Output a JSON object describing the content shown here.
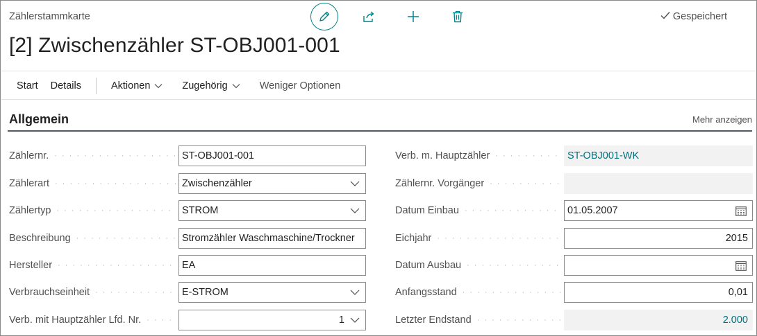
{
  "header": {
    "caption": "Zählerstammkarte",
    "title": "[2] Zwischenzähler ST-OBJ001-001",
    "status": "Gespeichert",
    "icons": [
      "edit-pencil-icon",
      "share-icon",
      "add-icon",
      "delete-icon",
      "checkmark-icon"
    ]
  },
  "actionbar": {
    "start": "Start",
    "details": "Details",
    "aktionen": "Aktionen",
    "zugehoerig": "Zugehörig",
    "weniger": "Weniger Optionen"
  },
  "section": {
    "title": "Allgemein",
    "more": "Mehr anzeigen"
  },
  "left": [
    {
      "label": "Zählernr.",
      "value": "ST-OBJ001-001"
    },
    {
      "label": "Zählerart",
      "value": "Zwischenzähler"
    },
    {
      "label": "Zählertyp",
      "value": "STROM"
    },
    {
      "label": "Beschreibung",
      "value": "Stromzähler Waschmaschine/Trockner"
    },
    {
      "label": "Hersteller",
      "value": "EA"
    },
    {
      "label": "Verbrauchseinheit",
      "value": "E-STROM"
    },
    {
      "label": "Verb. mit Hauptzähler Lfd. Nr.",
      "value": "1"
    }
  ],
  "right": [
    {
      "label": "Verb. m. Hauptzähler",
      "value": "ST-OBJ001-WK"
    },
    {
      "label": "Zählernr. Vorgänger",
      "value": ""
    },
    {
      "label": "Datum Einbau",
      "value": "01.05.2007"
    },
    {
      "label": "Eichjahr",
      "value": "2015"
    },
    {
      "label": "Datum Ausbau",
      "value": ""
    },
    {
      "label": "Anfangsstand",
      "value": "0,01"
    },
    {
      "label": "Letzter Endstand",
      "value": "2.000"
    }
  ],
  "colors": {
    "accent": "#00848a",
    "link": "#00707a",
    "readonly_bg": "#f2f2f2",
    "section_rule": "#505a66"
  }
}
